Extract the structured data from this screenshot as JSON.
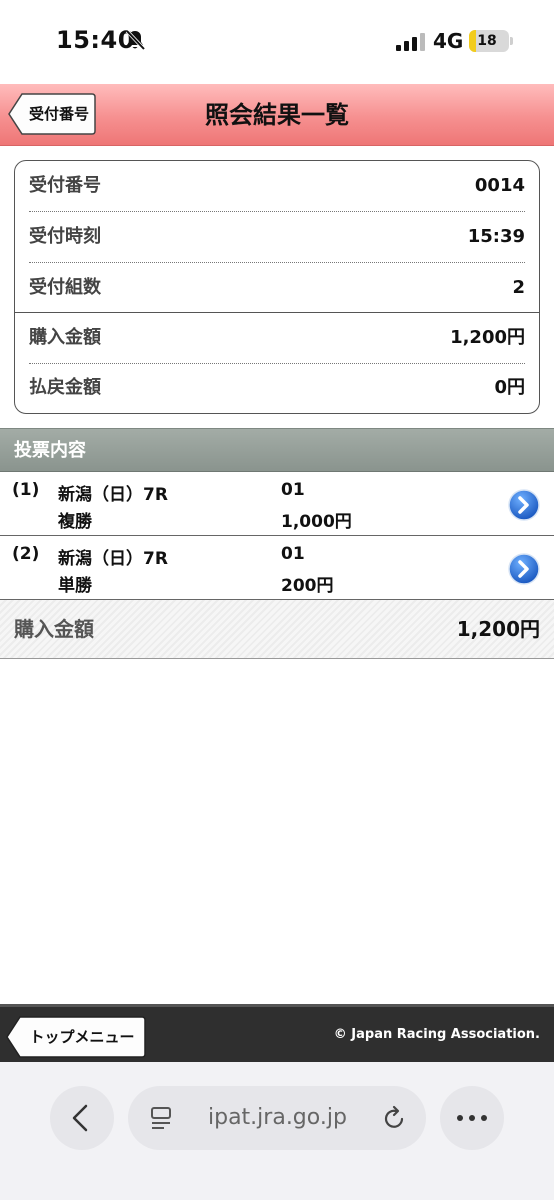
{
  "status_bar": {
    "time": "15:40",
    "network": "4G",
    "battery_level": "18",
    "battery_fraction": 0.18
  },
  "header": {
    "back_label": "受付番号",
    "title": "照会結果一覧"
  },
  "summary": {
    "rows": [
      {
        "label": "受付番号",
        "value": "0014"
      },
      {
        "label": "受付時刻",
        "value": "15:39"
      },
      {
        "label": "受付組数",
        "value": "2"
      },
      {
        "label": "購入金額",
        "value": "1,200円"
      },
      {
        "label": "払戻金額",
        "value": "0円"
      }
    ]
  },
  "section": {
    "title": "投票内容"
  },
  "bets": [
    {
      "number": "(1)",
      "race": "新潟（日）7R",
      "bet_type": "複勝",
      "horse": "01",
      "amount": "1,000円"
    },
    {
      "number": "(2)",
      "race": "新潟（日）7R",
      "bet_type": "単勝",
      "horse": "01",
      "amount": "200円"
    }
  ],
  "total": {
    "label": "購入金額",
    "value": "1,200円"
  },
  "footer": {
    "top_menu_label": "トップメニュー",
    "copyright": "© Japan Racing Association."
  },
  "browser": {
    "url": "ipat.jra.go.jp"
  },
  "colors": {
    "header_pink": "#f69090",
    "section_gray": "#8a948e",
    "arrow_blue": "#2a6fd0",
    "footer_dark": "#2f2f2f"
  }
}
